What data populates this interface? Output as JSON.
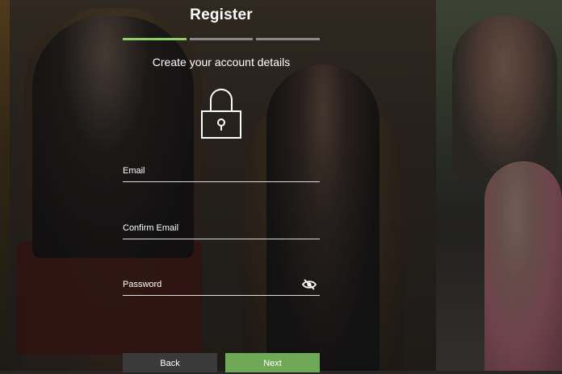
{
  "header": {
    "title": "Register"
  },
  "progress": {
    "steps": 3,
    "current_step": 1,
    "active_color": "#8dd06a"
  },
  "form": {
    "subtitle": "Create your account details",
    "lock_icon": "padlock-icon",
    "fields": {
      "email": {
        "label": "Email",
        "value": ""
      },
      "confirm_email": {
        "label": "Confirm Email",
        "value": ""
      },
      "password": {
        "label": "Password",
        "value": "",
        "toggle_icon": "eye-slash-icon"
      }
    }
  },
  "buttons": {
    "back_label": "Back",
    "next_label": "Next",
    "next_color": "#6fa957"
  }
}
